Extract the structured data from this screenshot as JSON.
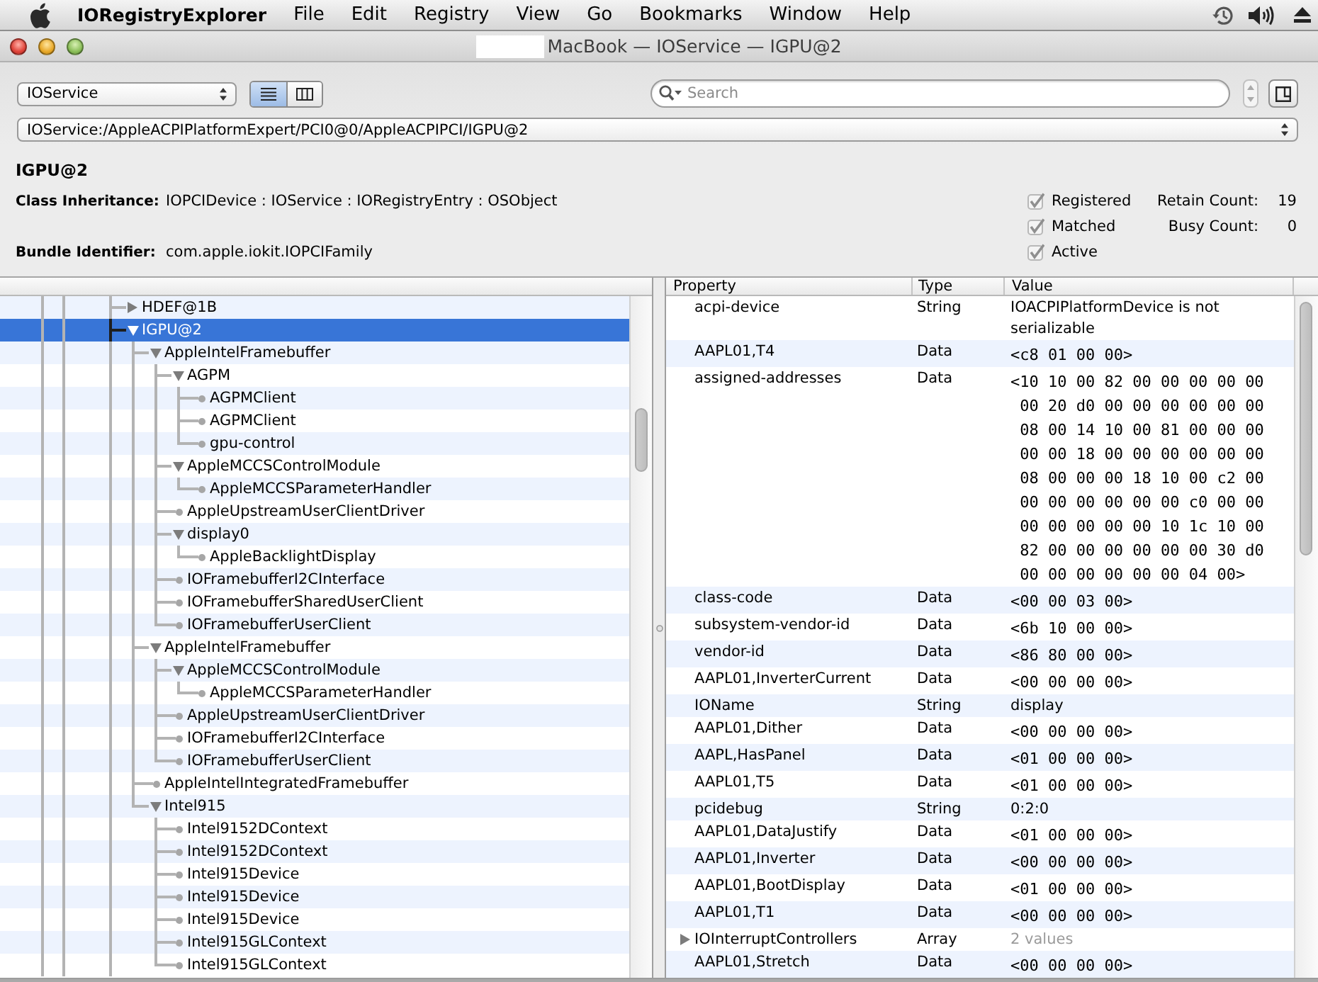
{
  "menu_bar": {
    "app_name": "IORegistryExplorer",
    "items": [
      "File",
      "Edit",
      "Registry",
      "View",
      "Go",
      "Bookmarks",
      "Window",
      "Help"
    ]
  },
  "window": {
    "title": "MacBook — IOService — IGPU@2"
  },
  "toolbar": {
    "plane": "IOService",
    "view_modes": [
      {
        "kind": "list",
        "selected": true
      },
      {
        "kind": "columns",
        "selected": false
      }
    ],
    "search": {
      "placeholder": "Search"
    },
    "path": "IOService:/AppleACPIPlatformExpert/PCI0@0/AppleACPIPCI/IGPU@2"
  },
  "inspector": {
    "name": "IGPU@2",
    "class_inheritance": {
      "label": "Class Inheritance:",
      "value": "IOPCIDevice : IOService : IORegistryEntry : OSObject"
    },
    "bundle_identifier": {
      "label": "Bundle Identifier:",
      "value": "com.apple.iokit.IOPCIFamily"
    },
    "flags": [
      {
        "label": "Registered",
        "checked": true,
        "disabled": true
      },
      {
        "label": "Matched",
        "checked": true,
        "disabled": true
      },
      {
        "label": "Active",
        "checked": true,
        "disabled": true
      }
    ],
    "counts": [
      {
        "label": "Retain Count:",
        "value": "19"
      },
      {
        "label": "Busy Count:",
        "value": "0"
      }
    ]
  },
  "tree": {
    "items": [
      {
        "name": "HDEF@1B",
        "kind": "branch",
        "expanded": false,
        "selected": false
      },
      {
        "name": "IGPU@2",
        "kind": "branch",
        "expanded": true,
        "selected": true,
        "children": [
          {
            "name": "AppleIntelFramebuffer",
            "kind": "branch",
            "expanded": true,
            "selected": false,
            "children": [
              {
                "name": "AGPM",
                "kind": "branch",
                "expanded": true,
                "selected": false,
                "children": [
                  {
                    "name": "AGPMClient",
                    "kind": "leaf",
                    "selected": false
                  },
                  {
                    "name": "AGPMClient",
                    "kind": "leaf",
                    "selected": false
                  },
                  {
                    "name": "gpu-control",
                    "kind": "leaf",
                    "selected": false
                  }
                ]
              },
              {
                "name": "AppleMCCSControlModule",
                "kind": "branch",
                "expanded": true,
                "selected": false,
                "children": [
                  {
                    "name": "AppleMCCSParameterHandler",
                    "kind": "leaf",
                    "selected": false
                  }
                ]
              },
              {
                "name": "AppleUpstreamUserClientDriver",
                "kind": "leaf",
                "selected": false
              },
              {
                "name": "display0",
                "kind": "branch",
                "expanded": true,
                "selected": false,
                "children": [
                  {
                    "name": "AppleBacklightDisplay",
                    "kind": "leaf",
                    "selected": false
                  }
                ]
              },
              {
                "name": "IOFramebufferI2CInterface",
                "kind": "leaf",
                "selected": false
              },
              {
                "name": "IOFramebufferSharedUserClient",
                "kind": "leaf",
                "selected": false
              },
              {
                "name": "IOFramebufferUserClient",
                "kind": "leaf",
                "selected": false
              }
            ]
          },
          {
            "name": "AppleIntelFramebuffer",
            "kind": "branch",
            "expanded": true,
            "selected": false,
            "children": [
              {
                "name": "AppleMCCSControlModule",
                "kind": "branch",
                "expanded": true,
                "selected": false,
                "children": [
                  {
                    "name": "AppleMCCSParameterHandler",
                    "kind": "leaf",
                    "selected": false
                  }
                ]
              },
              {
                "name": "AppleUpstreamUserClientDriver",
                "kind": "leaf",
                "selected": false
              },
              {
                "name": "IOFramebufferI2CInterface",
                "kind": "leaf",
                "selected": false
              },
              {
                "name": "IOFramebufferUserClient",
                "kind": "leaf",
                "selected": false
              }
            ]
          },
          {
            "name": "AppleIntelIntegratedFramebuffer",
            "kind": "leaf",
            "selected": false
          },
          {
            "name": "Intel915",
            "kind": "branch",
            "expanded": true,
            "selected": false,
            "children": [
              {
                "name": "Intel9152DContext",
                "kind": "leaf",
                "selected": false
              },
              {
                "name": "Intel9152DContext",
                "kind": "leaf",
                "selected": false
              },
              {
                "name": "Intel915Device",
                "kind": "leaf",
                "selected": false
              },
              {
                "name": "Intel915Device",
                "kind": "leaf",
                "selected": false
              },
              {
                "name": "Intel915Device",
                "kind": "leaf",
                "selected": false
              },
              {
                "name": "Intel915GLContext",
                "kind": "leaf",
                "selected": false
              },
              {
                "name": "Intel915GLContext",
                "kind": "leaf",
                "selected": false
              }
            ]
          }
        ]
      }
    ]
  },
  "properties": {
    "columns": [
      "Property",
      "Type",
      "Value"
    ],
    "rows": [
      {
        "property": "acpi-device",
        "type": "String",
        "value": "IOACPIPlatformDevice is not serializable",
        "kind": "string"
      },
      {
        "property": "AAPL01,T4",
        "type": "Data",
        "value": "<c8 01 00 00>",
        "kind": "data"
      },
      {
        "property": "assigned-addresses",
        "type": "Data",
        "value": "<10 10 00 82 00 00 00 00 00\n 00 20 d0 00 00 00 00 00 00\n 08 00 14 10 00 81 00 00 00\n 00 00 18 00 00 00 00 00 00\n 08 00 00 00 18 10 00 c2 00\n 00 00 00 00 00 00 c0 00 00\n 00 00 00 00 00 10 1c 10 00\n 82 00 00 00 00 00 00 30 d0\n 00 00 00 00 00 00 04 00>",
        "kind": "data"
      },
      {
        "property": "class-code",
        "type": "Data",
        "value": "<00 00 03 00>",
        "kind": "data"
      },
      {
        "property": "subsystem-vendor-id",
        "type": "Data",
        "value": "<6b 10 00 00>",
        "kind": "data"
      },
      {
        "property": "vendor-id",
        "type": "Data",
        "value": "<86 80 00 00>",
        "kind": "data"
      },
      {
        "property": "AAPL01,InverterCurrent",
        "type": "Data",
        "value": "<00 00 00 00>",
        "kind": "data"
      },
      {
        "property": "IOName",
        "type": "String",
        "value": "display",
        "kind": "string"
      },
      {
        "property": "AAPL01,Dither",
        "type": "Data",
        "value": "<00 00 00 00>",
        "kind": "data"
      },
      {
        "property": "AAPL,HasPanel",
        "type": "Data",
        "value": "<01 00 00 00>",
        "kind": "data"
      },
      {
        "property": "AAPL01,T5",
        "type": "Data",
        "value": "<01 00 00 00>",
        "kind": "data"
      },
      {
        "property": "pcidebug",
        "type": "String",
        "value": "0:2:0",
        "kind": "string"
      },
      {
        "property": "AAPL01,DataJustify",
        "type": "Data",
        "value": "<01 00 00 00>",
        "kind": "data"
      },
      {
        "property": "AAPL01,Inverter",
        "type": "Data",
        "value": "<00 00 00 00>",
        "kind": "data"
      },
      {
        "property": "AAPL01,BootDisplay",
        "type": "Data",
        "value": "<01 00 00 00>",
        "kind": "data"
      },
      {
        "property": "AAPL01,T1",
        "type": "Data",
        "value": "<00 00 00 00>",
        "kind": "data"
      },
      {
        "property": "IOInterruptControllers",
        "type": "Array",
        "value": "2 values",
        "kind": "array",
        "expanded": false
      },
      {
        "property": "AAPL01,Stretch",
        "type": "Data",
        "value": "<00 00 00 00>",
        "kind": "data"
      }
    ]
  }
}
